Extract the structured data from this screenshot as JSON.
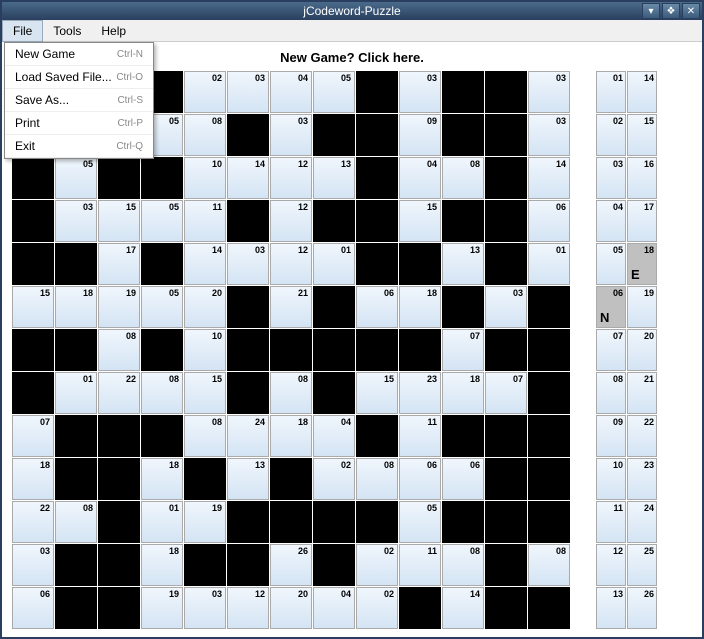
{
  "window": {
    "title": "jCodeword-Puzzle"
  },
  "menubar": {
    "items": [
      "File",
      "Tools",
      "Help"
    ]
  },
  "dropdown": {
    "items": [
      {
        "label": "New Game",
        "shortcut": "Ctrl-N"
      },
      {
        "label": "Load Saved File...",
        "shortcut": "Ctrl-O"
      },
      {
        "label": "Save As...",
        "shortcut": "Ctrl-S"
      },
      {
        "label": "Print",
        "shortcut": "Ctrl-P"
      },
      {
        "label": "Exit",
        "shortcut": "Ctrl-Q"
      }
    ]
  },
  "hint": "New Game? Click here.",
  "grid": {
    "cols": 13,
    "rows": 13,
    "cells": [
      [
        "",
        "",
        "",
        "",
        "02",
        "03",
        "04",
        "05",
        "",
        "03",
        "",
        "",
        "03"
      ],
      [
        "",
        "",
        "",
        "05",
        "08",
        "",
        "03",
        "",
        "",
        "09",
        "",
        "",
        "03"
      ],
      [
        "",
        "05",
        "",
        "",
        "10",
        "14",
        "12",
        "13",
        "",
        "04",
        "08",
        "",
        "14"
      ],
      [
        "",
        "03",
        "15",
        "05",
        "11",
        "",
        "12",
        "",
        "",
        "15",
        "",
        "",
        "06"
      ],
      [
        "",
        "",
        "17",
        "",
        "14",
        "03",
        "12",
        "01",
        "",
        "",
        "13",
        "",
        "01"
      ],
      [
        "15",
        "18",
        "19",
        "05",
        "20",
        "",
        "21",
        "",
        "06",
        "18",
        "",
        "03",
        ""
      ],
      [
        "",
        "",
        "08",
        "",
        "10",
        "",
        "",
        "",
        "",
        "",
        "07",
        "",
        ""
      ],
      [
        "",
        "01",
        "22",
        "08",
        "15",
        "",
        "08",
        "",
        "15",
        "23",
        "18",
        "07",
        ""
      ],
      [
        "07",
        "",
        "",
        "",
        "08",
        "24",
        "18",
        "04",
        "",
        "11",
        "",
        "",
        ""
      ],
      [
        "18",
        "",
        "",
        "18",
        "",
        "13",
        "",
        "02",
        "08",
        "06",
        "06",
        "",
        ""
      ],
      [
        "22",
        "08",
        "",
        "01",
        "19",
        "",
        "",
        "",
        "",
        "05",
        "",
        "",
        ""
      ],
      [
        "03",
        "",
        "",
        "18",
        "",
        "",
        "26",
        "",
        "02",
        "11",
        "08",
        "",
        "08"
      ],
      [
        "06",
        "",
        "",
        "19",
        "03",
        "12",
        "20",
        "04",
        "02",
        "",
        "14",
        "",
        ""
      ]
    ]
  },
  "sidebar": {
    "rows": [
      [
        "01",
        "14"
      ],
      [
        "02",
        "15"
      ],
      [
        "03",
        "16"
      ],
      [
        "04",
        "17"
      ],
      [
        "05",
        {
          "num": "18",
          "letter": "E",
          "solved": true
        }
      ],
      [
        {
          "num": "06",
          "letter": "N",
          "solved": true
        },
        "19"
      ],
      [
        "07",
        "20"
      ],
      [
        "08",
        "21"
      ],
      [
        "09",
        "22"
      ],
      [
        "10",
        "23"
      ],
      [
        "11",
        "24"
      ],
      [
        "12",
        "25"
      ],
      [
        "13",
        "26"
      ]
    ]
  }
}
